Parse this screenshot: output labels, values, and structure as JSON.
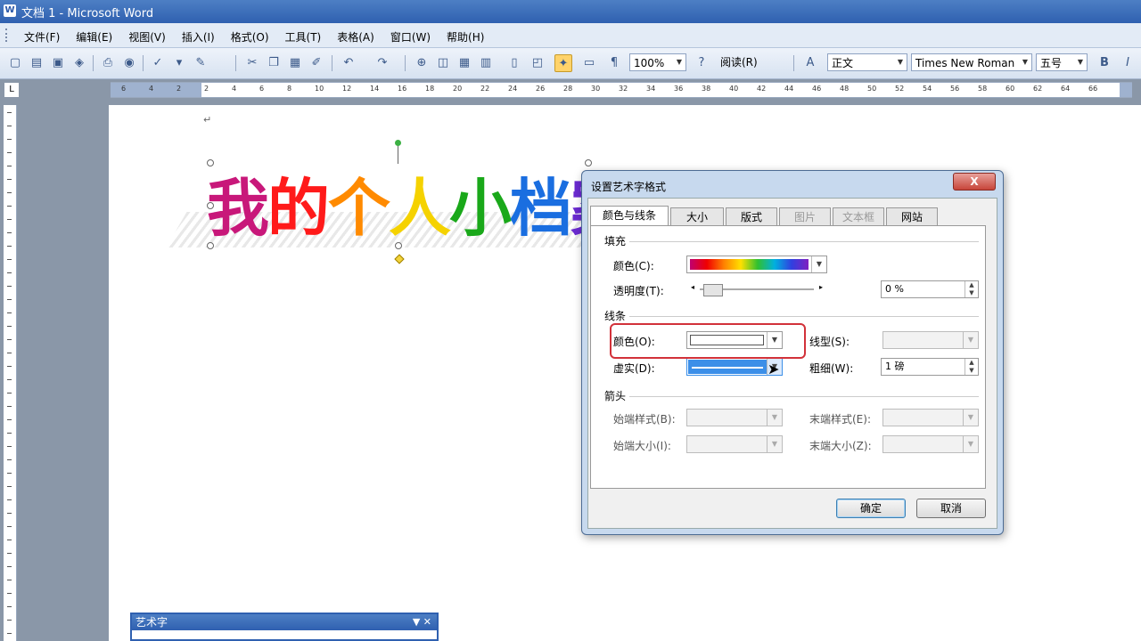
{
  "window": {
    "title": "文档 1 - Microsoft Word",
    "icon": "word-icon"
  },
  "menu": [
    "文件(F)",
    "编辑(E)",
    "视图(V)",
    "插入(I)",
    "格式(O)",
    "工具(T)",
    "表格(A)",
    "窗口(W)",
    "帮助(H)"
  ],
  "toolbar": {
    "zoom": "100%",
    "read_label": "阅读(R)",
    "style": "正文",
    "font": "Times New Roman",
    "size": "五号",
    "bold_label": "B",
    "italic_label": "I"
  },
  "ruler": {
    "ticks": [
      "6",
      "4",
      "2",
      "2",
      "4",
      "6",
      "8",
      "10",
      "12",
      "14",
      "16",
      "18",
      "20",
      "22",
      "24",
      "26",
      "28",
      "30",
      "32",
      "34",
      "36",
      "38",
      "40",
      "42",
      "44",
      "46",
      "48",
      "50",
      "52",
      "54",
      "56",
      "58",
      "60",
      "62",
      "64",
      "66"
    ]
  },
  "wordart": {
    "chars": [
      "我",
      "的",
      "个",
      "人",
      "小",
      "档",
      "案"
    ],
    "colors": [
      "#c8187a",
      "#ff1a1a",
      "#ff8a00",
      "#f5d200",
      "#1aa81a",
      "#1a6ee0",
      "#6a2ad0"
    ]
  },
  "dialog": {
    "title": "设置艺术字格式",
    "close_label": "X",
    "tabs": [
      "颜色与线条",
      "大小",
      "版式",
      "图片",
      "文本框",
      "网站"
    ],
    "fill": {
      "section": "填充",
      "color_label": "颜色(C):",
      "transparency_label": "透明度(T):",
      "transparency_value": "0 %"
    },
    "line": {
      "section": "线条",
      "color_label": "颜色(O):",
      "style_label": "线型(S):",
      "dash_label": "虚实(D):",
      "weight_label": "粗细(W):",
      "weight_value": "1 磅"
    },
    "arrows": {
      "section": "箭头",
      "begin_style_label": "始端样式(B):",
      "end_style_label": "末端样式(E):",
      "begin_size_label": "始端大小(I):",
      "end_size_label": "末端大小(Z):"
    },
    "ok_label": "确定",
    "cancel_label": "取消"
  },
  "wordart_toolbar": {
    "title": "艺术字",
    "controls": "▼ ✕"
  }
}
